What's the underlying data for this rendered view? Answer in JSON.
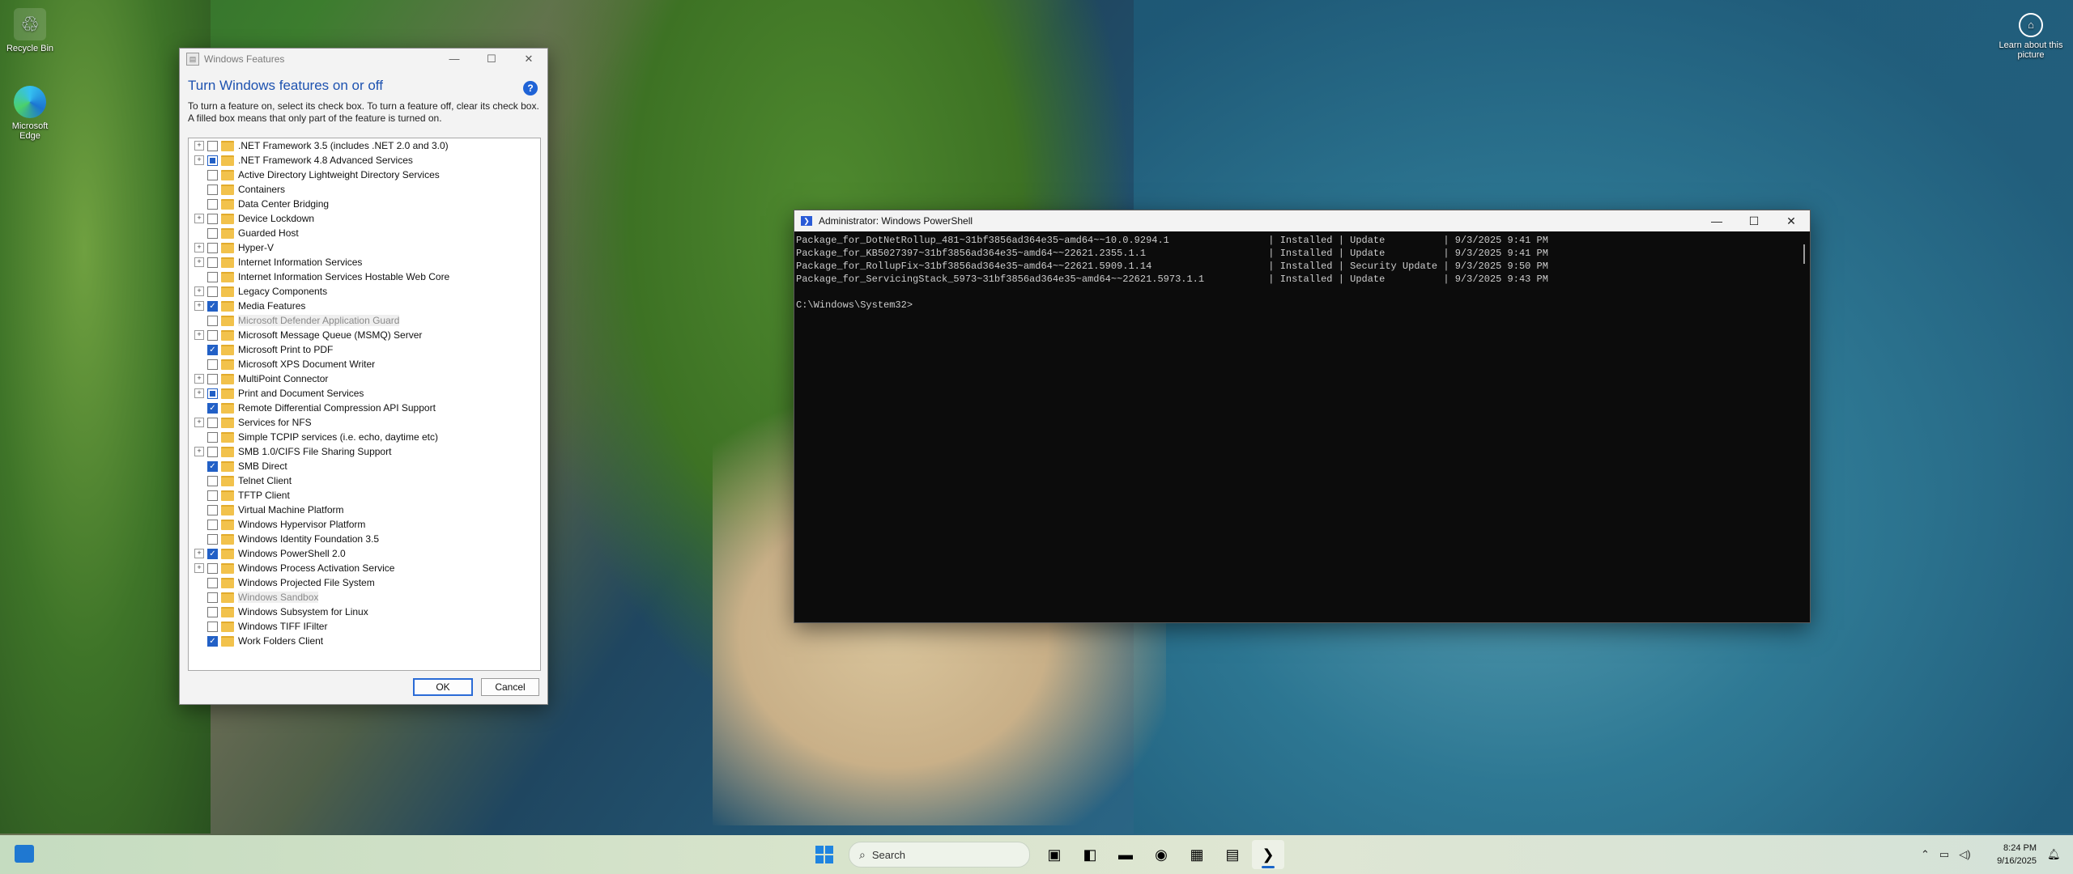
{
  "desktop": {
    "icons": [
      {
        "label": "Recycle Bin",
        "icon": "recycle-bin-icon"
      },
      {
        "label": "Microsoft Edge",
        "icon": "edge-icon"
      }
    ],
    "learn": {
      "label": "Learn about this picture",
      "icon": "camera-info-icon"
    }
  },
  "features_window": {
    "title": "Windows Features",
    "heading": "Turn Windows features on or off",
    "description": "To turn a feature on, select its check box. To turn a feature off, clear its check box. A filled box means that only part of the feature is turned on.",
    "help_label": "?",
    "ok_label": "OK",
    "cancel_label": "Cancel",
    "features": [
      {
        "label": ".NET Framework 3.5 (includes .NET 2.0 and 3.0)",
        "expandable": true,
        "state": "off"
      },
      {
        "label": ".NET Framework 4.8 Advanced Services",
        "expandable": true,
        "state": "partial"
      },
      {
        "label": "Active Directory Lightweight Directory Services",
        "expandable": false,
        "state": "off"
      },
      {
        "label": "Containers",
        "expandable": false,
        "state": "off"
      },
      {
        "label": "Data Center Bridging",
        "expandable": false,
        "state": "off"
      },
      {
        "label": "Device Lockdown",
        "expandable": true,
        "state": "off"
      },
      {
        "label": "Guarded Host",
        "expandable": false,
        "state": "off"
      },
      {
        "label": "Hyper-V",
        "expandable": true,
        "state": "off"
      },
      {
        "label": "Internet Information Services",
        "expandable": true,
        "state": "off"
      },
      {
        "label": "Internet Information Services Hostable Web Core",
        "expandable": false,
        "state": "off"
      },
      {
        "label": "Legacy Components",
        "expandable": true,
        "state": "off"
      },
      {
        "label": "Media Features",
        "expandable": true,
        "state": "on"
      },
      {
        "label": "Microsoft Defender Application Guard",
        "expandable": false,
        "state": "disabled"
      },
      {
        "label": "Microsoft Message Queue (MSMQ) Server",
        "expandable": true,
        "state": "off"
      },
      {
        "label": "Microsoft Print to PDF",
        "expandable": false,
        "state": "on"
      },
      {
        "label": "Microsoft XPS Document Writer",
        "expandable": false,
        "state": "off"
      },
      {
        "label": "MultiPoint Connector",
        "expandable": true,
        "state": "off"
      },
      {
        "label": "Print and Document Services",
        "expandable": true,
        "state": "partial"
      },
      {
        "label": "Remote Differential Compression API Support",
        "expandable": false,
        "state": "on"
      },
      {
        "label": "Services for NFS",
        "expandable": true,
        "state": "off"
      },
      {
        "label": "Simple TCPIP services (i.e. echo, daytime etc)",
        "expandable": false,
        "state": "off"
      },
      {
        "label": "SMB 1.0/CIFS File Sharing Support",
        "expandable": true,
        "state": "off"
      },
      {
        "label": "SMB Direct",
        "expandable": false,
        "state": "on"
      },
      {
        "label": "Telnet Client",
        "expandable": false,
        "state": "off"
      },
      {
        "label": "TFTP Client",
        "expandable": false,
        "state": "off"
      },
      {
        "label": "Virtual Machine Platform",
        "expandable": false,
        "state": "off"
      },
      {
        "label": "Windows Hypervisor Platform",
        "expandable": false,
        "state": "off"
      },
      {
        "label": "Windows Identity Foundation 3.5",
        "expandable": false,
        "state": "off"
      },
      {
        "label": "Windows PowerShell 2.0",
        "expandable": true,
        "state": "on"
      },
      {
        "label": "Windows Process Activation Service",
        "expandable": true,
        "state": "off"
      },
      {
        "label": "Windows Projected File System",
        "expandable": false,
        "state": "off"
      },
      {
        "label": "Windows Sandbox",
        "expandable": false,
        "state": "disabled"
      },
      {
        "label": "Windows Subsystem for Linux",
        "expandable": false,
        "state": "off"
      },
      {
        "label": "Windows TIFF IFilter",
        "expandable": false,
        "state": "off"
      },
      {
        "label": "Work Folders Client",
        "expandable": false,
        "state": "on"
      }
    ]
  },
  "powershell": {
    "title": "Administrator: Windows PowerShell",
    "lines": [
      "Package_for_DotNetRollup_481~31bf3856ad364e35~amd64~~10.0.9294.1                 | Installed | Update          | 9/3/2025 9:41 PM",
      "Package_for_KB5027397~31bf3856ad364e35~amd64~~22621.2355.1.1                     | Installed | Update          | 9/3/2025 9:41 PM",
      "Package_for_RollupFix~31bf3856ad364e35~amd64~~22621.5909.1.14                    | Installed | Security Update | 9/3/2025 9:50 PM",
      "Package_for_ServicingStack_5973~31bf3856ad364e35~amd64~~22621.5973.1.1           | Installed | Update          | 9/3/2025 9:43 PM",
      "",
      "C:\\Windows\\System32>"
    ]
  },
  "taskbar": {
    "search_placeholder": "Search",
    "apps": [
      {
        "name": "task-view-icon",
        "glyph": "▣"
      },
      {
        "name": "office-icon",
        "glyph": "◧"
      },
      {
        "name": "file-explorer-icon",
        "glyph": "▬"
      },
      {
        "name": "edge-taskbar-icon",
        "glyph": "◉"
      },
      {
        "name": "store-icon",
        "glyph": "▦"
      },
      {
        "name": "control-panel-icon",
        "glyph": "▤"
      },
      {
        "name": "powershell-taskbar-icon",
        "glyph": "❯"
      }
    ],
    "time": "8:24 PM",
    "date": "9/16/2025"
  }
}
